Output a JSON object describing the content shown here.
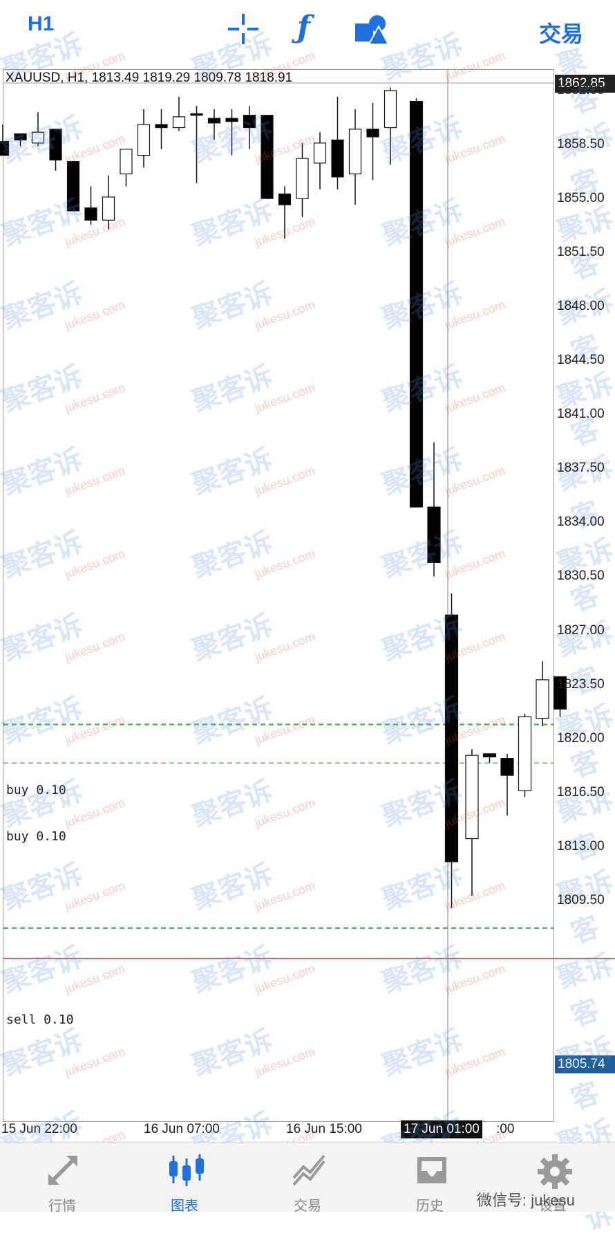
{
  "toolbar": {
    "timeframe": "H1",
    "trade_label": "交易",
    "accent_color": "#1f6fe0"
  },
  "symbol": {
    "info": "XAUUSD, H1, 1813.49 1819.29 1809.78 1818.91"
  },
  "price_axis": {
    "labels": [
      "1862.00",
      "1858.50",
      "1855.00",
      "1851.50",
      "1848.00",
      "1844.50",
      "1841.00",
      "1837.50",
      "1834.00",
      "1830.50",
      "1827.00",
      "1823.50",
      "1820.00",
      "1816.50",
      "1813.00",
      "1809.50"
    ],
    "current_price": "1862.85",
    "bid_price": "1805.74"
  },
  "time_axis": {
    "labels": [
      "15 Jun 22:00",
      "16 Jun 07:00",
      "16 Jun 15:00"
    ],
    "cursor_label": "17 Jun 01:00",
    "cursor_trailing": ":00"
  },
  "orders": [
    {
      "label": "buy 0.10",
      "price": 1820.9
    },
    {
      "label": "buy 0.10",
      "price": 1818.4
    },
    {
      "label": "sell 0.10",
      "price": 1807.7
    }
  ],
  "bid_line_price": 1805.74,
  "chart_data": {
    "type": "candlestick",
    "symbol": "XAUUSD",
    "timeframe": "H1",
    "ylim": [
      1802.5,
      1863.6
    ],
    "candles": [
      {
        "o": 1858.7,
        "h": 1859.8,
        "l": 1857.8,
        "c": 1857.8
      },
      {
        "o": 1859.2,
        "h": 1859.2,
        "l": 1858.4,
        "c": 1858.8
      },
      {
        "o": 1858.6,
        "h": 1860.6,
        "l": 1858.4,
        "c": 1859.3
      },
      {
        "o": 1859.5,
        "h": 1859.5,
        "l": 1856.8,
        "c": 1857.5
      },
      {
        "o": 1857.4,
        "h": 1857.4,
        "l": 1854.2,
        "c": 1854.2
      },
      {
        "o": 1854.4,
        "h": 1855.8,
        "l": 1853.3,
        "c": 1853.6
      },
      {
        "o": 1853.6,
        "h": 1856.5,
        "l": 1853.0,
        "c": 1855.1
      },
      {
        "o": 1856.6,
        "h": 1857.9,
        "l": 1855.8,
        "c": 1858.2
      },
      {
        "o": 1857.8,
        "h": 1860.8,
        "l": 1857.0,
        "c": 1859.8
      },
      {
        "o": 1859.8,
        "h": 1860.8,
        "l": 1858.2,
        "c": 1859.6
      },
      {
        "o": 1859.6,
        "h": 1861.6,
        "l": 1859.4,
        "c": 1860.3
      },
      {
        "o": 1860.5,
        "h": 1861.0,
        "l": 1856.0,
        "c": 1860.4
      },
      {
        "o": 1860.2,
        "h": 1860.8,
        "l": 1858.8,
        "c": 1859.9
      },
      {
        "o": 1860.2,
        "h": 1860.8,
        "l": 1857.8,
        "c": 1860.0
      },
      {
        "o": 1860.4,
        "h": 1861.0,
        "l": 1858.2,
        "c": 1859.6
      },
      {
        "o": 1860.4,
        "h": 1860.4,
        "l": 1855.0,
        "c": 1855.0
      },
      {
        "o": 1855.3,
        "h": 1855.8,
        "l": 1852.4,
        "c": 1854.6
      },
      {
        "o": 1855.0,
        "h": 1858.6,
        "l": 1853.8,
        "c": 1857.6
      },
      {
        "o": 1857.3,
        "h": 1859.3,
        "l": 1855.6,
        "c": 1858.6
      },
      {
        "o": 1858.8,
        "h": 1861.6,
        "l": 1855.6,
        "c": 1856.4
      },
      {
        "o": 1856.6,
        "h": 1860.8,
        "l": 1854.6,
        "c": 1859.5
      },
      {
        "o": 1859.5,
        "h": 1861.2,
        "l": 1856.2,
        "c": 1859.0
      },
      {
        "o": 1859.6,
        "h": 1862.2,
        "l": 1857.2,
        "c": 1862.0
      },
      {
        "o": 1861.3,
        "h": 1861.5,
        "l": 1835.0,
        "c": 1835.0
      },
      {
        "o": 1835.0,
        "h": 1839.2,
        "l": 1830.5,
        "c": 1831.4
      },
      {
        "o": 1828.0,
        "h": 1829.4,
        "l": 1809.0,
        "c": 1812.0
      },
      {
        "o": 1813.5,
        "h": 1819.3,
        "l": 1809.8,
        "c": 1818.9
      },
      {
        "o": 1819.0,
        "h": 1819.0,
        "l": 1818.4,
        "c": 1818.8
      },
      {
        "o": 1818.7,
        "h": 1819.0,
        "l": 1815.0,
        "c": 1817.6
      },
      {
        "o": 1816.6,
        "h": 1821.6,
        "l": 1816.2,
        "c": 1821.4
      },
      {
        "o": 1821.3,
        "h": 1825.0,
        "l": 1820.8,
        "c": 1823.8
      },
      {
        "o": 1824.0,
        "h": 1824.0,
        "l": 1821.4,
        "c": 1821.9
      }
    ]
  },
  "bottom_nav": {
    "items": [
      "行情",
      "图表",
      "交易",
      "历史",
      "设置"
    ]
  },
  "wechat": "微信号: jukesu",
  "watermark": {
    "cn": "聚客诉",
    "en": "jukesu.com"
  }
}
